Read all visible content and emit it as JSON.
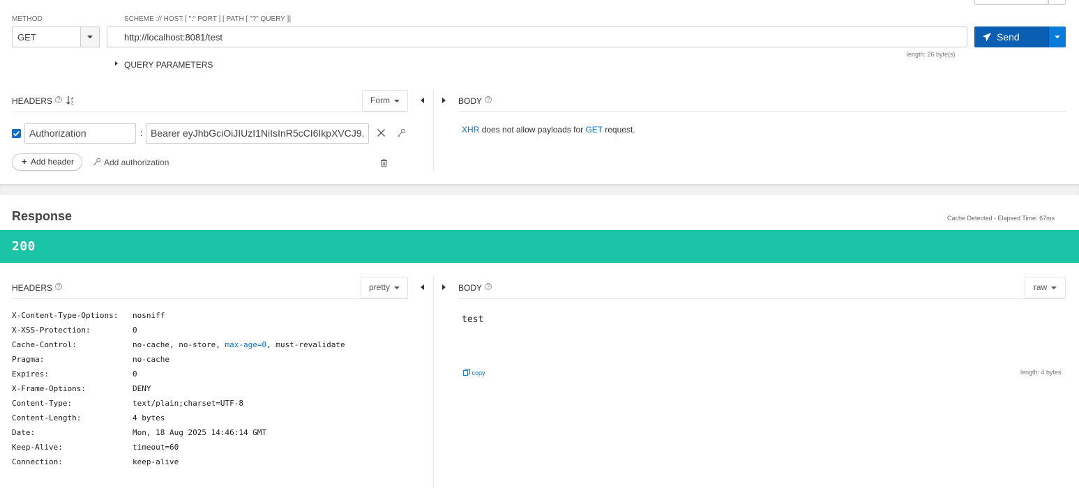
{
  "request": {
    "method_label": "METHOD",
    "method": "GET",
    "url_label": "SCHEME :// HOST [ \":\" PORT ] [ PATH [ \"?\" QUERY ]]",
    "url": "http://localhost:8081/test",
    "url_length": "length: 26 byte(s)",
    "send_label": "Send",
    "query_params_label": "QUERY PARAMETERS"
  },
  "request_headers": {
    "title": "HEADERS",
    "format": "Form",
    "items": [
      {
        "enabled": true,
        "name": "Authorization",
        "separator": ":",
        "value": "Bearer eyJhbGciOiJIUzI1NiIsInR5cCI6IkpXVCJ9."
      }
    ],
    "add_header_label": "Add header",
    "add_authorization_label": "Add authorization"
  },
  "request_body": {
    "title": "BODY",
    "message_part1": "XHR",
    "message_part2": "does not allow payloads for",
    "message_part3": "GET",
    "message_part4": "request."
  },
  "response": {
    "title": "Response",
    "cache_info": "Cache Detected - Elapsed Time: 67ms",
    "status_code": "200",
    "status_color": "#1bc3a7",
    "headers_title": "HEADERS",
    "headers_format": "pretty",
    "headers": [
      {
        "name": "X-Content-Type-Options:",
        "value": "nosniff"
      },
      {
        "name": "X-XSS-Protection:",
        "value": "0"
      },
      {
        "name": "Cache-Control:",
        "value_before": "no-cache, no-store, ",
        "value_link": "max-age=0",
        "value_after": ", must-revalidate"
      },
      {
        "name": "Pragma:",
        "value": "no-cache"
      },
      {
        "name": "Expires:",
        "value": "0"
      },
      {
        "name": "X-Frame-Options:",
        "value": "DENY"
      },
      {
        "name": "Content-Type:",
        "value": "text/plain;charset=UTF-8"
      },
      {
        "name": "Content-Length:",
        "value": "4 bytes"
      },
      {
        "name": "Date:",
        "value": "Mon, 18 Aug 2025 14:46:14 GMT"
      },
      {
        "name": "Keep-Alive:",
        "value": "timeout=60"
      },
      {
        "name": "Connection:",
        "value": "keep-alive"
      }
    ],
    "body_title": "BODY",
    "body_format": "raw",
    "body_content": "test",
    "copy_label": "copy",
    "body_length": "length: 4 bytes"
  },
  "colors": {
    "accent": "#0b5fb3",
    "link": "#0b73c4"
  }
}
